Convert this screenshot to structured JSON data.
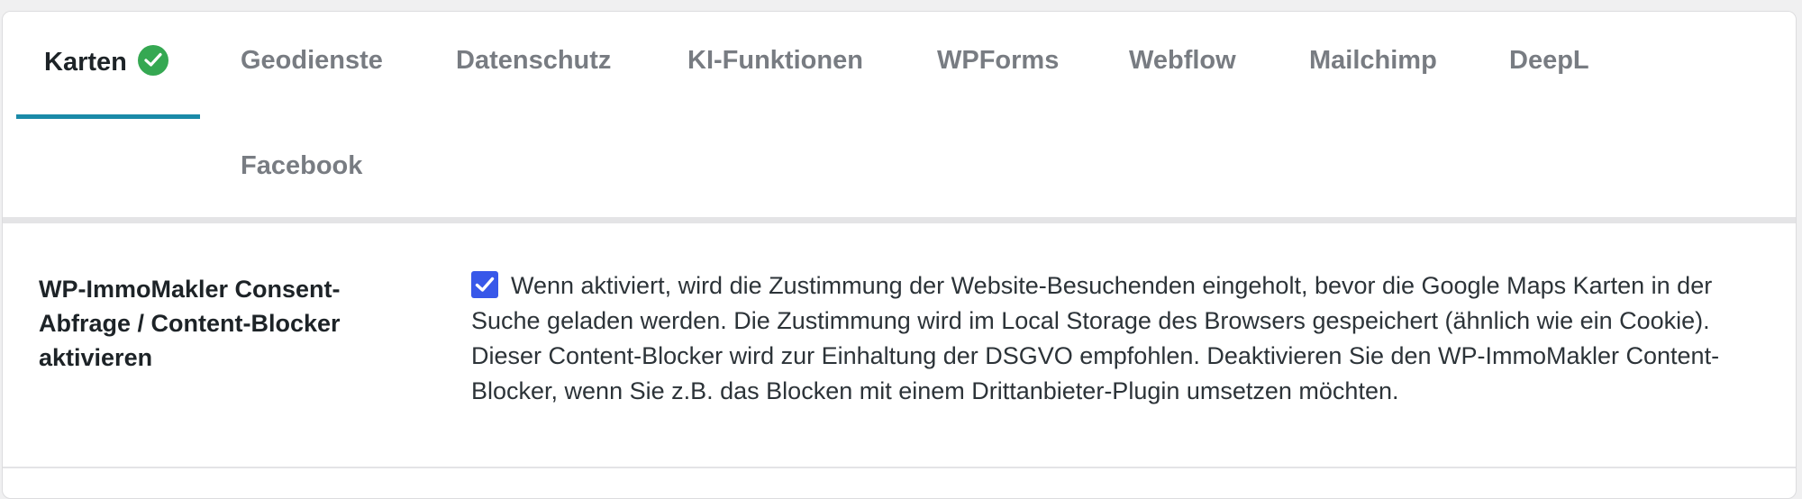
{
  "tabs": [
    {
      "label": "Karten",
      "active": true,
      "badge": "check-icon"
    },
    {
      "label": "Geodienste"
    },
    {
      "label": "Datenschutz"
    },
    {
      "label": "KI-Funktionen"
    },
    {
      "label": "WPForms"
    },
    {
      "label": "Webflow"
    },
    {
      "label": "Mailchimp"
    },
    {
      "label": "DeepL"
    },
    {
      "label": "Facebook"
    }
  ],
  "setting": {
    "label": "WP-ImmoMakler Consent-Abfrage / Content-Blocker aktivieren",
    "checked": true,
    "description": "Wenn aktiviert, wird die Zustimmung der Website-Besuchenden eingeholt, bevor die Google Maps Karten in der Suche geladen werden. Die Zustimmung wird im Local Storage des Browsers gespeichert (ähnlich wie ein Cookie).",
    "description_2": "Dieser Content-Blocker wird zur Einhaltung der DSGVO empfohlen. Deaktivieren Sie den WP-ImmoMakler Content-Blocker, wenn Sie z.B. das Blocken mit einem Drittanbieter-Plugin umsetzen möchten."
  },
  "colors": {
    "active_tab_underline": "#1a8aa8",
    "check_badge": "#35a852",
    "checkbox": "#3858e9",
    "inactive_tab": "#787c82"
  }
}
